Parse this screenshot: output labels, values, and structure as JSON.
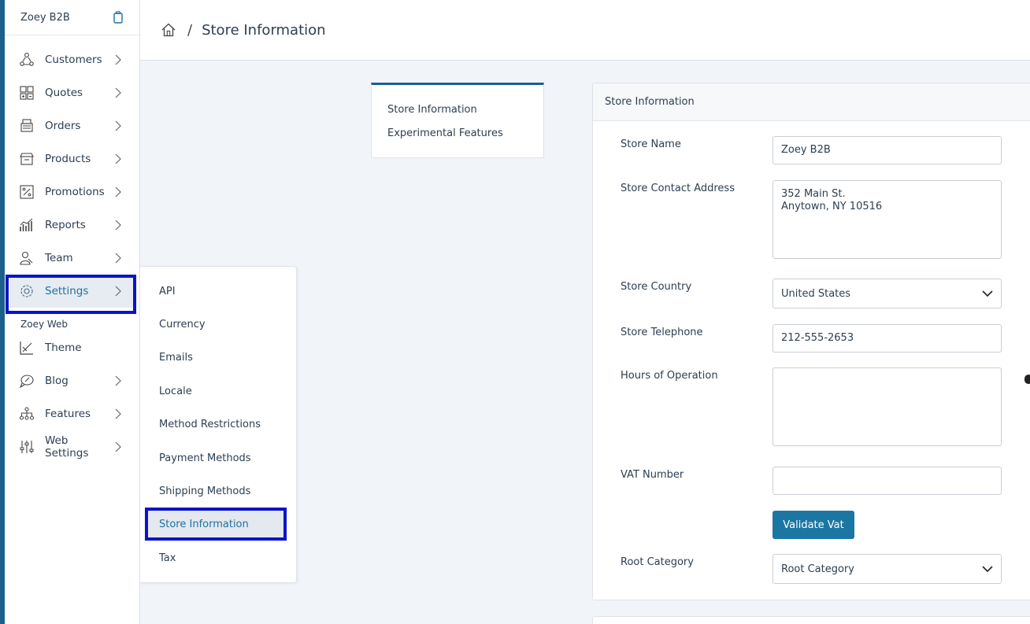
{
  "sidebar": {
    "brand": "Zoey B2B",
    "items": [
      {
        "label": "Customers",
        "icon": "customers-icon"
      },
      {
        "label": "Quotes",
        "icon": "quotes-icon"
      },
      {
        "label": "Orders",
        "icon": "orders-icon"
      },
      {
        "label": "Products",
        "icon": "products-icon"
      },
      {
        "label": "Promotions",
        "icon": "promotions-icon"
      },
      {
        "label": "Reports",
        "icon": "reports-icon"
      },
      {
        "label": "Team",
        "icon": "team-icon"
      },
      {
        "label": "Settings",
        "icon": "gear-icon"
      }
    ],
    "section_label": "Zoey Web",
    "web_items": [
      {
        "label": "Theme",
        "icon": "theme-icon"
      },
      {
        "label": "Blog",
        "icon": "blog-icon"
      },
      {
        "label": "Features",
        "icon": "features-icon"
      },
      {
        "label": "Web Settings",
        "icon": "sliders-icon"
      }
    ]
  },
  "header": {
    "separator": "/",
    "title": "Store Information"
  },
  "flyout": {
    "items": [
      "API",
      "Currency",
      "Emails",
      "Locale",
      "Method Restrictions",
      "Payment Methods",
      "Shipping Methods",
      "Store Information",
      "Tax"
    ],
    "active": "Store Information"
  },
  "subtabs": [
    "Store Information",
    "Experimental Features"
  ],
  "form": {
    "heading": "Store Information",
    "store_name_label": "Store Name",
    "store_name_value": "Zoey B2B",
    "address_label": "Store Contact Address",
    "address_value": "352 Main St.\nAnytown, NY 10516",
    "country_label": "Store Country",
    "country_value": "United States",
    "telephone_label": "Store Telephone",
    "telephone_value": "212-555-2653",
    "hours_label": "Hours of Operation",
    "hours_value": "",
    "vat_label": "VAT Number",
    "vat_value": "",
    "validate_button": "Validate Vat",
    "root_label": "Root Category",
    "root_value": "Root Category"
  },
  "colors": {
    "accent": "#1c5f8b",
    "button": "#1c76a3",
    "highlight": "#0a14c8"
  }
}
